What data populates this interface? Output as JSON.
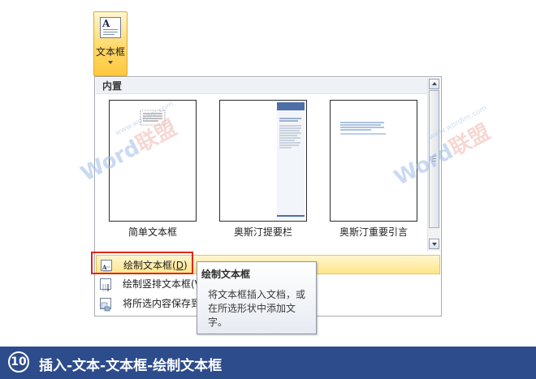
{
  "ribbon": {
    "text_box_label": "文本框",
    "icon": "text-box-icon"
  },
  "panel": {
    "section_header": "内置",
    "gallery": [
      {
        "caption": "简单文本框",
        "style": "simple"
      },
      {
        "caption": "奥斯汀提要栏",
        "style": "sidebar"
      },
      {
        "caption": "奥斯汀重要引言",
        "style": "quote"
      }
    ],
    "menu": [
      {
        "label": "绘制文本框(",
        "accel": "D",
        "suffix": ")",
        "icon": "draw-text-box-icon",
        "highlighted": true
      },
      {
        "label": "绘制竖排文本框(V",
        "icon": "draw-vertical-text-box-icon",
        "highlighted": false
      },
      {
        "label": "将所选内容保存到",
        "icon": "save-selection-icon",
        "highlighted": false
      }
    ]
  },
  "tooltip": {
    "title": "绘制文本框",
    "body": "将文本框插入文档，或在所选形状中添加文字。"
  },
  "watermark": {
    "word": "Word",
    "cn": "联盟",
    "url": "www.wordlm.com"
  },
  "caption_bar": {
    "step": "10",
    "text": "插入-文本-文本框-绘制文本框"
  },
  "colors": {
    "highlight": "#ffe58a",
    "bar": "#2d4c8c",
    "annotation": "#e0261c"
  }
}
